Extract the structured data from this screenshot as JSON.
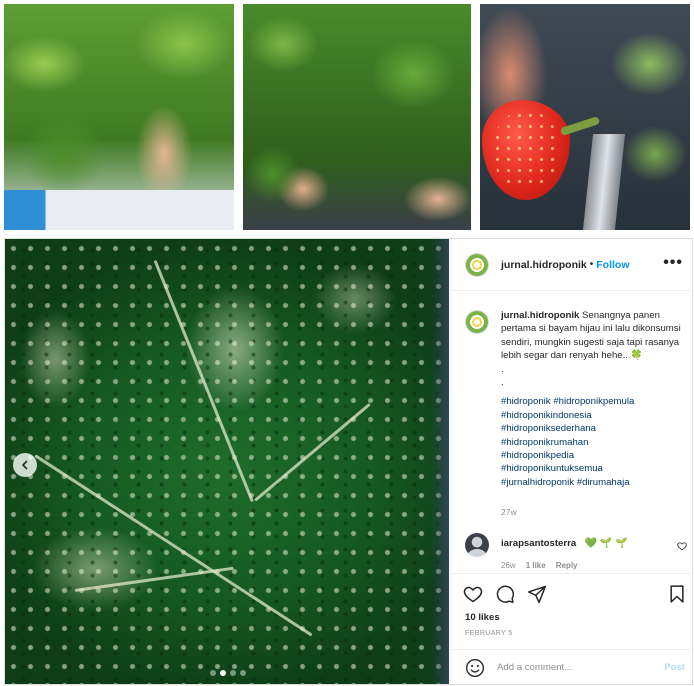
{
  "post": {
    "username": "jurnal.hidroponik",
    "separator": "•",
    "follow_label": "Follow",
    "more_label": "•••",
    "caption": {
      "username": "jurnal.hidroponik",
      "text": "Senangnya panen pertama si bayam hijau ini lalu dikonsumsi sendiri, mungkin sugesti saja tapi rasanya lebih segar dan renyah hehe..",
      "emoji": "🍀",
      "dots": [
        ".",
        "."
      ],
      "hashtag_rows": [
        [
          "#hidroponik",
          "#hidroponikpemula"
        ],
        [
          "#hidroponikindonesia"
        ],
        [
          "#hidroponiksederhana"
        ],
        [
          "#hidroponikrumahan"
        ],
        [
          "#hidroponikpedia"
        ],
        [
          "#hidroponikuntuksemua"
        ],
        [
          "#jurnalhidroponik",
          "#dirumahaja"
        ]
      ],
      "time": "27w"
    },
    "comment": {
      "username": "iarapsantosterra",
      "emojis": [
        "💚",
        "🌱",
        "🌱"
      ],
      "time": "26w",
      "likes": "1 like",
      "reply_label": "Reply"
    },
    "likes": "10 likes",
    "date": "FEBRUARY 5",
    "add_comment_placeholder": "Add a comment...",
    "post_label": "Post"
  },
  "carousel": {
    "dots": 4,
    "active_index": 1
  },
  "icons": {
    "left_arrow": "chevron-left-icon",
    "like": "heart-icon",
    "comment": "comment-icon",
    "share": "share-icon",
    "save": "bookmark-icon",
    "emoji": "emoji-icon",
    "comment_like": "heart-icon"
  },
  "colors": {
    "follow": "#0095f6",
    "hashtag": "#00376b",
    "muted": "#8e8e8e",
    "post_disabled": "#b2dffc"
  }
}
